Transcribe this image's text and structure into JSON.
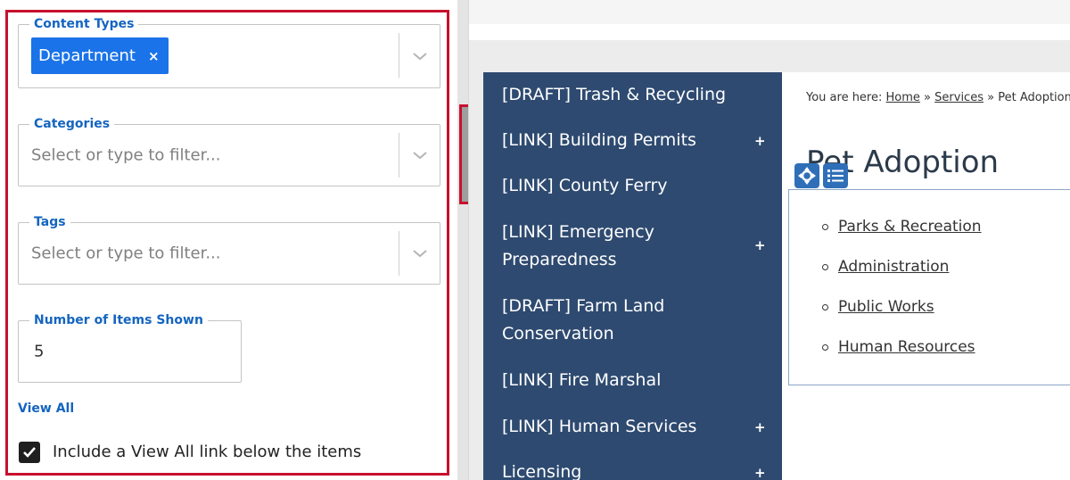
{
  "panel": {
    "content_types": {
      "legend": "Content Types",
      "chip_label": "Department",
      "chip_remove": "×"
    },
    "categories": {
      "legend": "Categories",
      "placeholder": "Select or type to filter..."
    },
    "tags": {
      "legend": "Tags",
      "placeholder": "Select or type to filter..."
    },
    "items_shown": {
      "legend": "Number of Items Shown",
      "value": "5"
    },
    "view_all_label": "View All",
    "include_view_all": {
      "checked": true,
      "label": "Include a View All link below the items"
    }
  },
  "preview": {
    "nav_items": [
      {
        "label": "[DRAFT] Trash & Recycling",
        "expandable": false
      },
      {
        "label": "[LINK] Building Permits",
        "expandable": true
      },
      {
        "label": "[LINK] County Ferry",
        "expandable": false
      },
      {
        "label": "[LINK] Emergency Preparedness",
        "expandable": true
      },
      {
        "label": "[DRAFT] Farm Land Conservation",
        "expandable": false
      },
      {
        "label": "[LINK] Fire Marshal",
        "expandable": false
      },
      {
        "label": "[LINK] Human Services",
        "expandable": true
      },
      {
        "label": "Licensing",
        "expandable": true
      }
    ],
    "nav_plus": "+",
    "breadcrumb": {
      "prefix": "You are here:",
      "home": "Home",
      "sep": "»",
      "services": "Services",
      "current": "Pet Adoption"
    },
    "page_title": "Pet Adoption",
    "list_items": [
      "Parks & Recreation",
      "Administration",
      "Public Works",
      "Human Resources"
    ]
  },
  "colors": {
    "accent": "#1a73e8",
    "highlight": "#c8102e",
    "nav_bg": "#2e4a70"
  },
  "icons": {
    "chevron": "chevron-down-icon",
    "check": "check-icon",
    "move": "move-icon",
    "list": "list-icon"
  }
}
